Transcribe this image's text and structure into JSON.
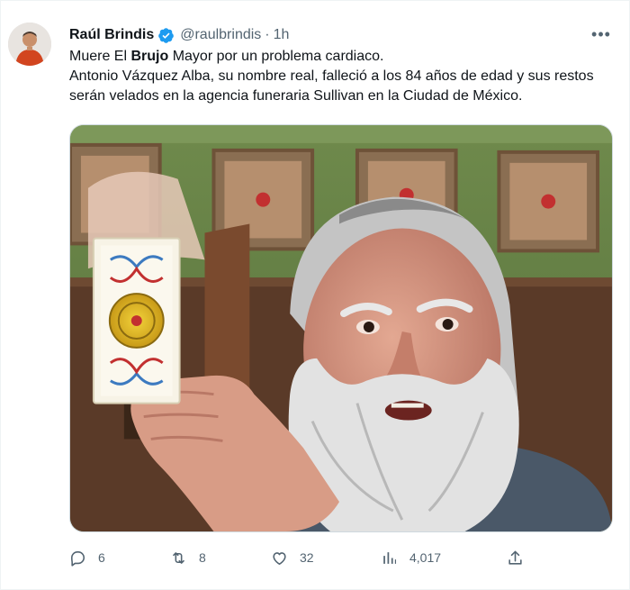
{
  "tweet": {
    "author": {
      "display_name": "Raúl Brindis",
      "handle": "@raulbrindis",
      "verified": true,
      "avatar_icon": "profile-avatar"
    },
    "separator": "·",
    "time": "1h",
    "text": {
      "line1_before": "Muere El ",
      "line1_bold": "Brujo",
      "line1_after": " Mayor por un problema cardiaco.",
      "line2": "Antonio Vázquez Alba, su nombre real, falleció a los 84 años de edad y sus restos serán velados en la agencia funeraria Sullivan en la Ciudad de México."
    },
    "media": {
      "type": "photo",
      "description_icon": "photo-man-holding-tarot-card"
    },
    "actions": {
      "reply": {
        "icon": "reply-icon",
        "count": "6"
      },
      "retweet": {
        "icon": "retweet-icon",
        "count": "8"
      },
      "like": {
        "icon": "heart-icon",
        "count": "32"
      },
      "views": {
        "icon": "analytics-icon",
        "count": "4,017"
      },
      "share": {
        "icon": "share-icon"
      }
    }
  },
  "colors": {
    "text_primary": "#0f1419",
    "text_secondary": "#536471",
    "verified_blue": "#1d9bf0",
    "border": "#eff3f4"
  }
}
